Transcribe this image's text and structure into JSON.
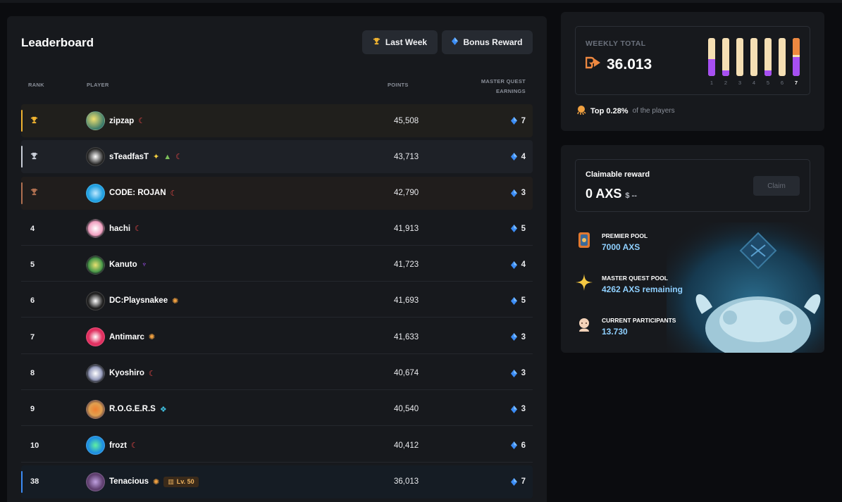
{
  "leaderboard": {
    "title": "Leaderboard",
    "buttons": {
      "last_week": "Last Week",
      "bonus_reward": "Bonus Reward"
    },
    "headers": {
      "rank": "RANK",
      "player": "PLAYER",
      "points": "POINTS",
      "earnings_line1": "MASTER QUEST",
      "earnings_line2": "EARNINGS"
    },
    "rows": [
      {
        "rank": "",
        "name": "zipzap",
        "points": "45,508",
        "earnings": "7"
      },
      {
        "rank": "",
        "name": "sTeadfasT",
        "points": "43,713",
        "earnings": "4"
      },
      {
        "rank": "",
        "name": "CODE: ROJAN",
        "points": "42,790",
        "earnings": "3"
      },
      {
        "rank": "4",
        "name": "hachi",
        "points": "41,913",
        "earnings": "5"
      },
      {
        "rank": "5",
        "name": "Kanuto",
        "points": "41,723",
        "earnings": "4"
      },
      {
        "rank": "6",
        "name": "DC:Playsnakee",
        "points": "41,693",
        "earnings": "5"
      },
      {
        "rank": "7",
        "name": "Antimarc",
        "points": "41,633",
        "earnings": "3"
      },
      {
        "rank": "8",
        "name": "Kyoshiro",
        "points": "40,674",
        "earnings": "3"
      },
      {
        "rank": "9",
        "name": "R.O.G.E.R.S",
        "points": "40,540",
        "earnings": "3"
      },
      {
        "rank": "10",
        "name": "frozt",
        "points": "40,412",
        "earnings": "6"
      },
      {
        "rank": "38",
        "name": "Tenacious",
        "points": "36,013",
        "earnings": "7",
        "level": "Lv. 50"
      }
    ]
  },
  "weekly": {
    "label": "WEEKLY TOTAL",
    "value": "36.013",
    "days": [
      "1",
      "2",
      "3",
      "4",
      "5",
      "6",
      "7"
    ],
    "day_fill": [
      0.45,
      0.15,
      0,
      0,
      0.15,
      0,
      0.5
    ],
    "top_label": "Top 0.28%",
    "top_suffix": "of the players"
  },
  "claim": {
    "label": "Claimable reward",
    "value": "0 AXS",
    "usd": "$ --",
    "button": "Claim"
  },
  "pools": [
    {
      "title": "PREMIER POOL",
      "value": "7000  AXS"
    },
    {
      "title": "MASTER QUEST POOL",
      "value": "4262  AXS remaining"
    },
    {
      "title": "CURRENT PARTICIPANTS",
      "value": "13.730"
    }
  ],
  "colors": {
    "accent_purple": "#a64ff2",
    "accent_cream": "#f5dfb4",
    "accent_orange": "#ee8840",
    "gem_blue": "#3b8cf5"
  }
}
